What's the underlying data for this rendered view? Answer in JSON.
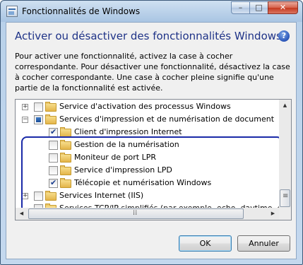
{
  "window": {
    "title": "Fonctionnalités de Windows",
    "minimize_glyph": "–",
    "maximize_glyph": "□",
    "close_glyph": "✕"
  },
  "header": {
    "title": "Activer ou désactiver des fonctionnalités Windows",
    "help_glyph": "?"
  },
  "description": "Pour activer une fonctionnalité, activez la case à cocher correspondante. Pour désactiver une fonctionnalité, désactivez la case à cocher correspondante. Une case à cocher pleine signifie qu'une partie de la fonctionnalité est activée.",
  "tree": {
    "items": [
      {
        "label": "Service d'activation des processus Windows",
        "state": "unchecked",
        "expander": "+",
        "level": 0
      },
      {
        "label": "Services d'impression et de numérisation de document",
        "state": "partial",
        "expander": "−",
        "level": 0
      },
      {
        "label": "Client d'impression Internet",
        "state": "checked",
        "level": 1
      },
      {
        "label": "Gestion de la numérisation",
        "state": "unchecked",
        "level": 1
      },
      {
        "label": "Moniteur de port LPR",
        "state": "unchecked",
        "level": 1
      },
      {
        "label": "Service d'impression LPD",
        "state": "unchecked",
        "level": 1
      },
      {
        "label": "Télécopie et numérisation Windows",
        "state": "checked",
        "level": 1
      },
      {
        "label": "Services Internet (IIS)",
        "state": "unchecked",
        "expander": "+",
        "level": 0
      },
      {
        "label": "Services TCP/IP simplifiés (par exemple, echo, daytime, etc.)",
        "state": "unchecked",
        "level": 0
      }
    ]
  },
  "buttons": {
    "ok": "OK",
    "cancel": "Annuler"
  },
  "colors": {
    "header_title": "#1e3287",
    "highlight_outline": "#1a2aa8"
  }
}
